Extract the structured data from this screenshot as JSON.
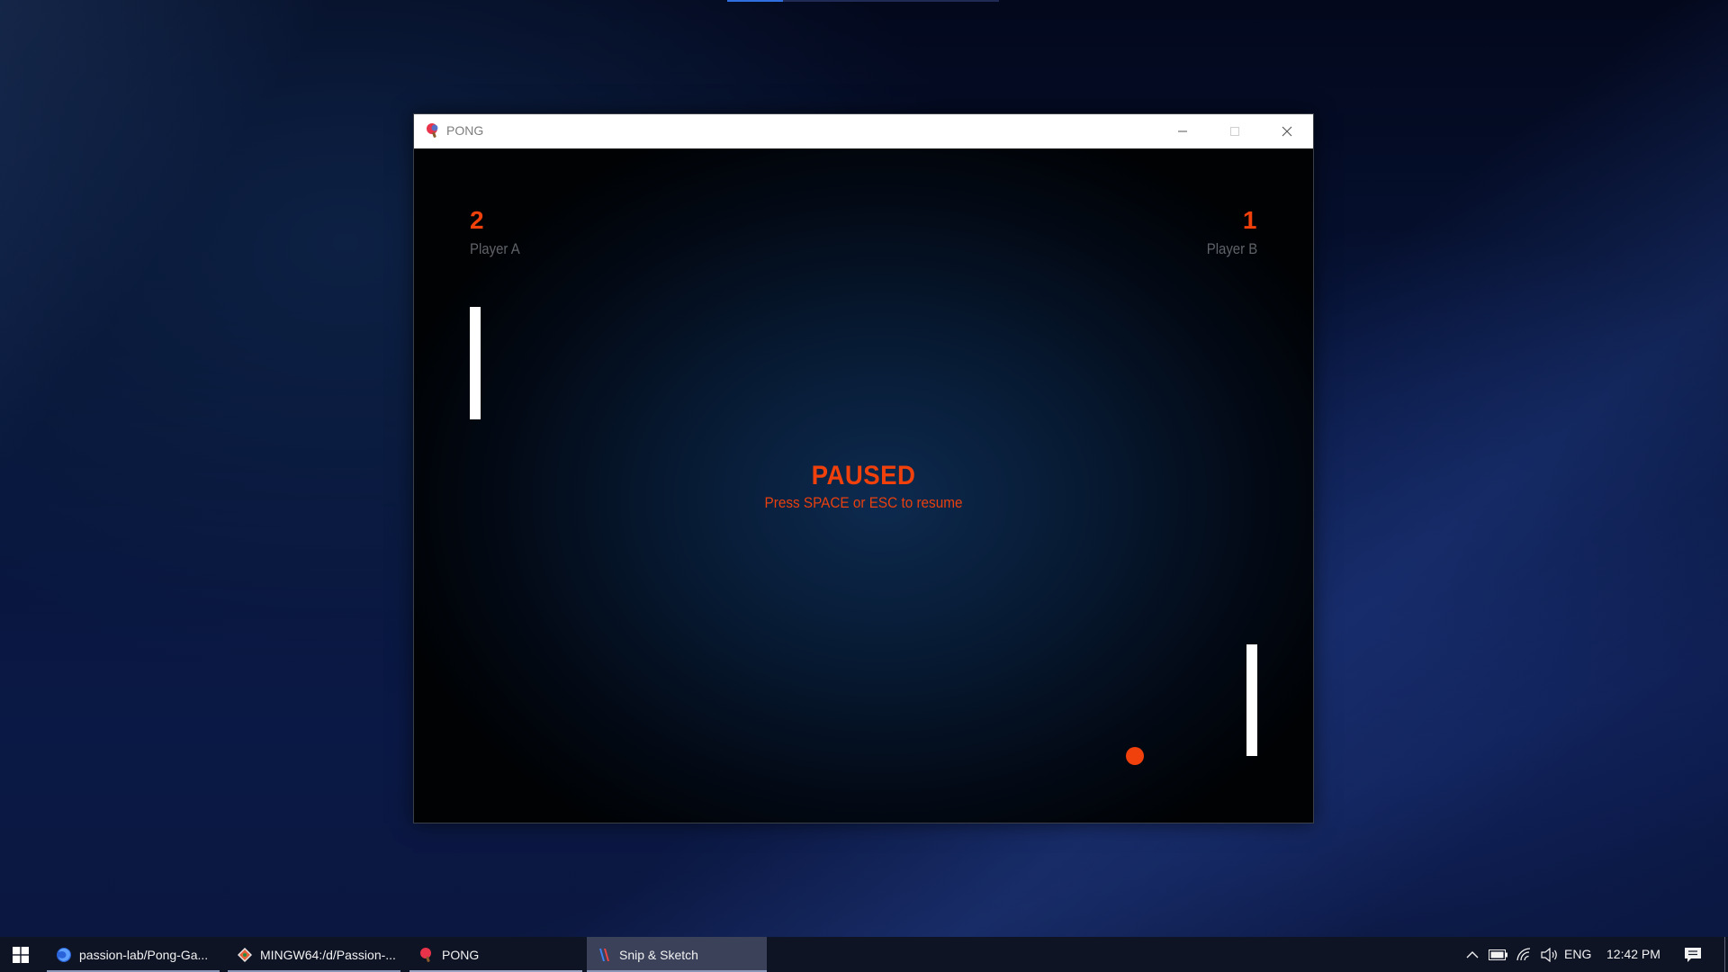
{
  "window": {
    "title": "PONG",
    "icon": "ping-pong-paddle-icon"
  },
  "game": {
    "player_a": {
      "score": "2",
      "label": "Player A"
    },
    "player_b": {
      "score": "1",
      "label": "Player B"
    },
    "pause_title": "PAUSED",
    "pause_hint": "Press SPACE or ESC to resume",
    "accent_color": "#f0400c"
  },
  "taskbar": {
    "items": [
      {
        "label": "passion-lab/Pong-Ga...",
        "icon": "firefox-icon"
      },
      {
        "label": "MINGW64:/d/Passion-...",
        "icon": "git-bash-icon"
      },
      {
        "label": "PONG",
        "icon": "ping-pong-paddle-icon"
      },
      {
        "label": "Snip & Sketch",
        "icon": "snip-sketch-icon"
      }
    ],
    "tray": {
      "language": "ENG",
      "time": "12:42 PM"
    }
  }
}
